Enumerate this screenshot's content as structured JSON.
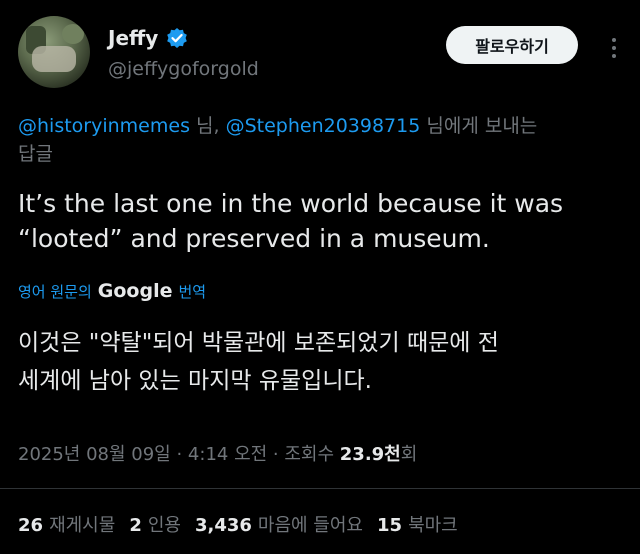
{
  "author": {
    "name": "Jeffy",
    "handle": "@jeffygoforgold",
    "verified": true
  },
  "follow_label": "팔로우하기",
  "reply_to": {
    "user1": "@historyinmemes",
    "sep1": " 님, ",
    "user2": "@Stephen20398715",
    "suffix": " 님에게 보내는",
    "line2": "답글"
  },
  "tweet": {
    "line1": "It’s the last one in the world because it was",
    "line2": "“looted” and preserved in a museum."
  },
  "translation": {
    "label": "영어 원문의",
    "google": "Google",
    "action": "번역",
    "line1": "이것은 \"약탈\"되어 박물관에 보존되었기 때문에 전",
    "line2": "세계에 남아 있는 마지막 유물입니다."
  },
  "meta": {
    "date": "2025년 08월 09일",
    "dot1": " · ",
    "time": "4:14 오전",
    "dot2": " · ",
    "views_label": "조회수 ",
    "views_value": "23.9천",
    "views_suffix": "회"
  },
  "stats": {
    "retweets_count": "26",
    "retweets_label": "재게시물",
    "quotes_count": "2",
    "quotes_label": "인용",
    "likes_count": "3,436",
    "likes_label": "마음에 들어요",
    "bookmarks_count": "15",
    "bookmarks_label": "북마크"
  },
  "colors": {
    "background": "#000000",
    "text": "#e7e9ea",
    "muted": "#71767b",
    "link": "#1d9bf0",
    "verified": "#1d9bf0"
  }
}
